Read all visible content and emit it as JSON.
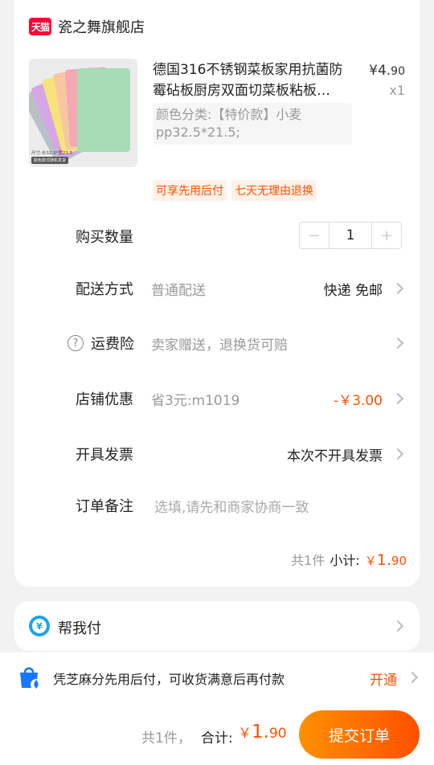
{
  "shop": {
    "badge": "天猫",
    "name": "瓷之舞旗舰店"
  },
  "product": {
    "title": "德国316不锈钢菜板家用抗菌防霉砧板厨房双面切菜板粘板…",
    "price_symbol": "¥",
    "price_int": "4.",
    "price_dec": "90",
    "qty": "x1",
    "sku": "颜色分类:【特价款】小麦pp32.5*21.5;",
    "thumb_note": "尺寸:长32.5*宽21.5",
    "thumb_tag": "颜色款式随机发货",
    "tags": [
      "可享先用后付",
      "七天无理由退换"
    ]
  },
  "quantity": {
    "label": "购买数量",
    "minus": "−",
    "value": "1",
    "plus": "+"
  },
  "delivery": {
    "label": "配送方式",
    "hint": "普通配送",
    "value": "快递 免邮"
  },
  "insurance": {
    "icon": "?",
    "label": "运费险",
    "hint": "卖家赠送，退换货可赔"
  },
  "discount": {
    "label": "店铺优惠",
    "hint": "省3元:m1019",
    "value": "-￥3.00"
  },
  "invoice": {
    "label": "开具发票",
    "value": "本次不开具发票"
  },
  "note": {
    "label": "订单备注",
    "placeholder": "选填,请先和商家协商一致"
  },
  "subtotal": {
    "count": "共1件",
    "label": "小计:",
    "symbol": "￥",
    "int": "1.",
    "dec": "90"
  },
  "help_pay": {
    "icon": "¥",
    "label": "帮我付"
  },
  "zhima": {
    "text": "凭芝麻分先用后付，可收货满意后再付款",
    "action": "开通"
  },
  "footer": {
    "count": "共1件，",
    "total_label": "合计:",
    "symbol": "￥",
    "total_int": "1.",
    "total_dec": "90",
    "submit": "提交订单"
  },
  "colors": {
    "accent": "#ff5000",
    "tmall": "#ff0036",
    "help_blue": "#1fa3f0"
  }
}
